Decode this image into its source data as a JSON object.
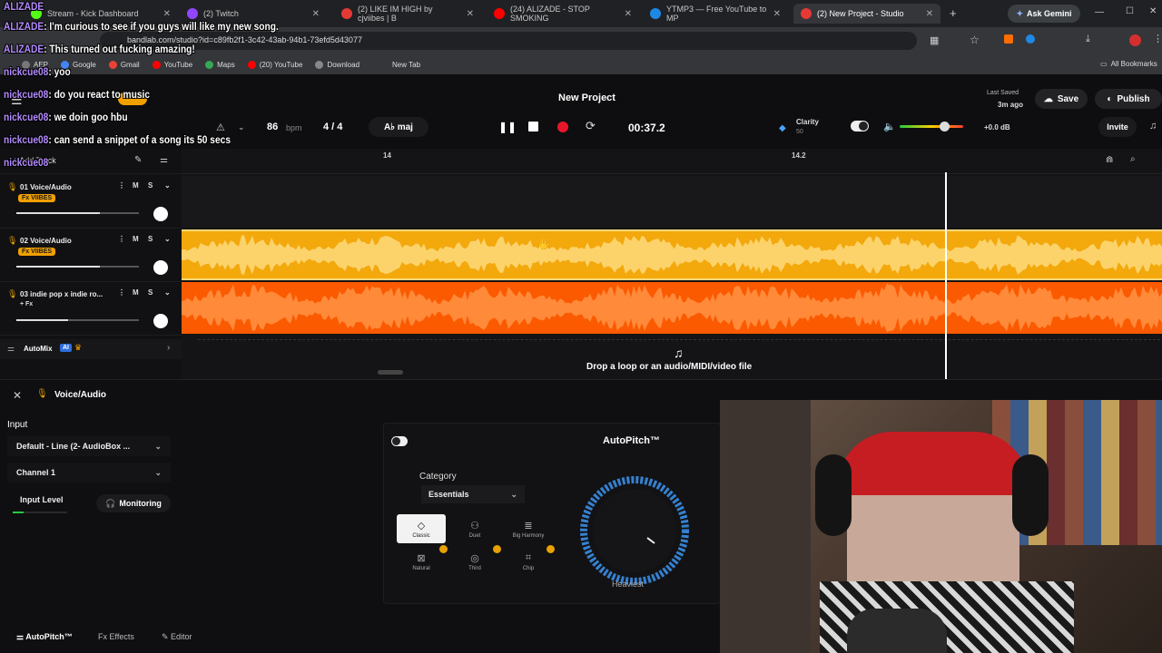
{
  "browser": {
    "tabs": [
      {
        "title": "Stream - Kick Dashboard",
        "color": "#53fc18"
      },
      {
        "title": "(2) Twitch",
        "color": "#9146ff"
      },
      {
        "title": "(2) LIKE IM HIGH by cjviibes | B",
        "color": "#e53935"
      },
      {
        "title": "(24) ALIZADE - STOP SMOKING",
        "color": "#ff0000"
      },
      {
        "title": "YTMP3 — Free YouTube to MP",
        "color": "#1e88e5"
      },
      {
        "title": "(2) New Project - Studio",
        "color": "#e53935"
      }
    ],
    "ask_gemini": "Ask Gemini",
    "url": "bandlab.com/studio?id=c89fb2f1-3c42-43ab-94b1-73efd5d43077",
    "bookmarks": [
      "AEP",
      "Google",
      "Gmail",
      "YouTube",
      "Maps",
      "(20) YouTube",
      "Download",
      "New Tab"
    ],
    "all_bookmarks": "All Bookmarks"
  },
  "chat": [
    {
      "name": "ALIZADE",
      "msg": ""
    },
    {
      "name": "ALIZADE",
      "msg": ": I'm curious to see if you guys will like my new song."
    },
    {
      "name": "ALIZADE",
      "msg": ": This turned out fucking amazing!"
    },
    {
      "name": "nickcue08",
      "msg": ": yoo"
    },
    {
      "name": "nickcue08",
      "msg": ": do you react to music"
    },
    {
      "name": "nickcue08",
      "msg": ": we doin goo hbu"
    },
    {
      "name": "nickcue08",
      "msg": ": can send a snippet of a song its 50 secs"
    },
    {
      "name": "nickcue08",
      "msg": ""
    }
  ],
  "studio": {
    "project_title": "New Project",
    "last_saved_label": "Last Saved",
    "last_saved_value": "3m ago",
    "save": "Save",
    "publish": "Publish",
    "invite": "Invite",
    "bpm": "86",
    "bpm_unit": "bpm",
    "time_sig": "4 / 4",
    "key": "A♭ maj",
    "time": "00:37.2",
    "clarity_label": "Clarity",
    "clarity_value": "50",
    "volume_db": "+0.0 dB",
    "ruler_marks": [
      "14",
      "14.2"
    ],
    "tracks": [
      {
        "num": "01",
        "name": "Voice/Audio",
        "fx": "Fx VIIBES",
        "volume": 0.68
      },
      {
        "num": "02",
        "name": "Voice/Audio",
        "fx": "Fx VIIBES",
        "volume": 0.68
      },
      {
        "num": "03",
        "name": "indie pop x indie ro...",
        "fx": "+ Fx",
        "volume": 0.42
      }
    ],
    "mute": "M",
    "solo": "S",
    "automix": "AutoMix",
    "automix_badge": "AI",
    "drop_hint": "Drop a loop or an audio/MIDI/video file",
    "add_track": "+ Add Track"
  },
  "panel": {
    "track_title": "Voice/Audio",
    "input_label": "Input",
    "input_device": "Default - Line (2- AudioBox ...",
    "channel": "Channel 1",
    "input_level": "Input Level",
    "monitoring": "Monitoring",
    "plugin_title": "AutoPitch™",
    "category_label": "Category",
    "category_value": "Essentials",
    "modes": [
      "Classic",
      "Duet",
      "Big Harmony",
      "Natural",
      "Third",
      "Chip"
    ],
    "knob_label": "Heaviest",
    "footer_tabs": [
      "AutoPitch™",
      "Effects",
      "Editor"
    ]
  },
  "colors": {
    "track2": "#f3a80c",
    "track3": "#fb5a00",
    "record": "#e8162b",
    "knob_arc": "#3a8ee6"
  }
}
